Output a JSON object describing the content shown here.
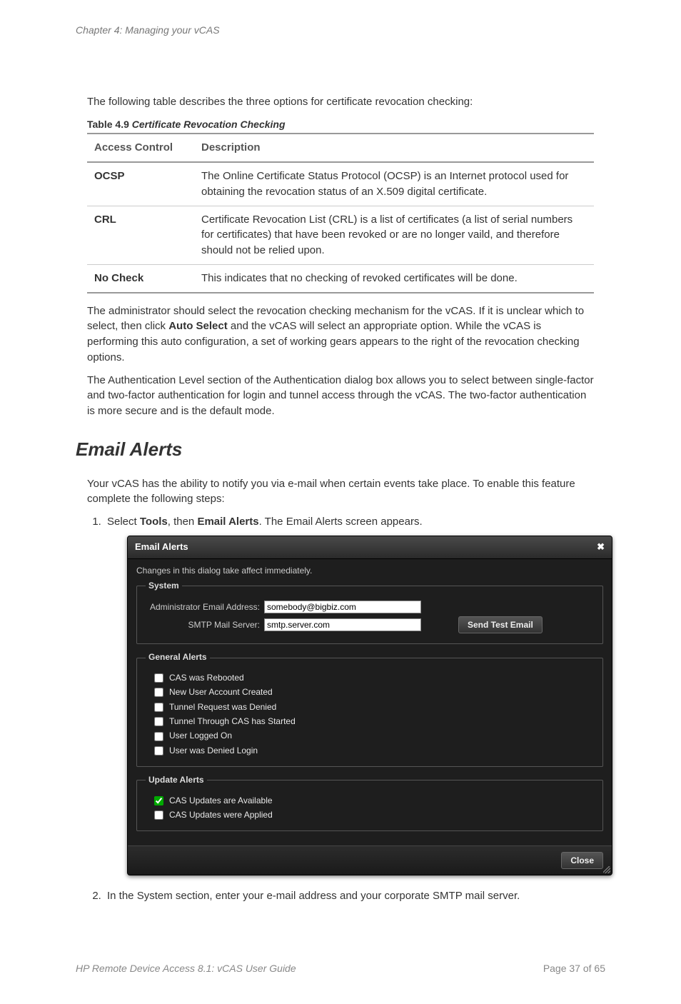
{
  "chapter_header": "Chapter 4: Managing your vCAS",
  "intro_text": "The following table describes the three options for certificate revocation checking:",
  "table": {
    "caption_prefix": "Table 4.9 ",
    "caption_title": "Certificate Revocation Checking",
    "headers": {
      "col1": "Access Control",
      "col2": "Description"
    },
    "rows": [
      {
        "name": "OCSP",
        "desc": "The Online Certificate Status Protocol (OCSP) is an Internet protocol used for obtaining the revocation status of an X.509 digital certificate."
      },
      {
        "name": "CRL",
        "desc": "Certificate Revocation List (CRL) is a list of certificates (a list of serial numbers for certificates) that have been revoked or are no longer vaild, and therefore should not be relied upon."
      },
      {
        "name": "No Check",
        "desc": "This indicates that no checking of revoked certificates will be done."
      }
    ]
  },
  "para_admin_a": "The administrator should select the revocation checking mechanism for the vCAS. If it is unclear which to select, then click ",
  "para_admin_bold": "Auto Select",
  "para_admin_b": " and the vCAS will select an appropriate option. While the vCAS is performing this auto configuration, a set of working gears appears to the right of the revocation checking options.",
  "para_auth": "The Authentication Level section of the Authentication dialog box allows you to select between single-factor and two-factor authentication for login and tunnel access through the vCAS. The two-factor authentication is more secure and is the default mode.",
  "section_title": "Email Alerts",
  "para_email_intro": "Your vCAS has the ability to notify you via e-mail when certain events take place. To enable this feature complete the following steps:",
  "steps": {
    "s1_a": "Select ",
    "s1_b1": "Tools",
    "s1_mid": ", then ",
    "s1_b2": "Email Alerts",
    "s1_c": ". The Email Alerts screen appears.",
    "s2": "In the System section, enter your e-mail address and your corporate SMTP mail server."
  },
  "dialog": {
    "title": "Email Alerts",
    "note": "Changes in this dialog take affect immediately.",
    "system": {
      "legend": "System",
      "admin_label": "Administrator Email Address:",
      "admin_value": "somebody@bigbiz.com",
      "smtp_label": "SMTP Mail Server:",
      "smtp_value": "smtp.server.com",
      "send_test_label": "Send Test Email"
    },
    "general": {
      "legend": "General Alerts",
      "items": [
        {
          "label": "CAS was Rebooted",
          "checked": false
        },
        {
          "label": "New User Account Created",
          "checked": false
        },
        {
          "label": "Tunnel Request was Denied",
          "checked": false
        },
        {
          "label": "Tunnel Through CAS has Started",
          "checked": false
        },
        {
          "label": "User Logged On",
          "checked": false
        },
        {
          "label": "User was Denied Login",
          "checked": false
        }
      ]
    },
    "update": {
      "legend": "Update Alerts",
      "items": [
        {
          "label": "CAS Updates are Available",
          "checked": true
        },
        {
          "label": "CAS Updates were Applied",
          "checked": false
        }
      ]
    },
    "close_label": "Close"
  },
  "footer": {
    "left": "HP Remote Device Access 8.1: vCAS User Guide",
    "right": "Page 37 of 65"
  }
}
